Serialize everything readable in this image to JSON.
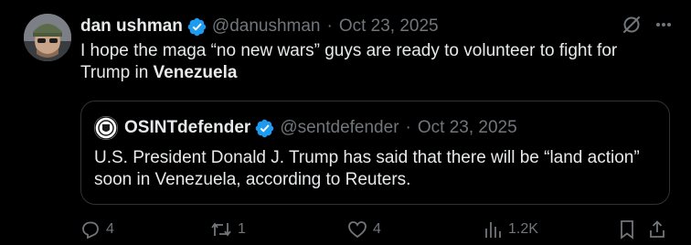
{
  "author": {
    "display_name": "dan ushman",
    "handle": "@danushman",
    "separator": "·",
    "date": "Oct 23, 2025"
  },
  "tweet": {
    "text_before": "I hope the maga “no new wars” guys are ready to volunteer to fight for Trump in ",
    "text_bold": "Venezuela"
  },
  "quoted": {
    "display_name": "OSINTdefender",
    "handle": "@sentdefender",
    "separator": "·",
    "date": "Oct 23, 2025",
    "text": "U.S. President Donald J. Trump has said that there will be “land action” soon in Venezuela, according to Reuters."
  },
  "actions": {
    "replies": "4",
    "reposts": "1",
    "likes": "4",
    "views": "1.2K"
  },
  "colors": {
    "background": "#000000",
    "text": "#e7e9ea",
    "muted": "#71767b",
    "verified": "#1d9bf0",
    "border": "#2f3336"
  },
  "icons": [
    "verified-badge-icon",
    "grok-icon",
    "more-icon",
    "reply-icon",
    "repost-icon",
    "like-icon",
    "views-icon",
    "bookmark-icon",
    "share-icon"
  ]
}
